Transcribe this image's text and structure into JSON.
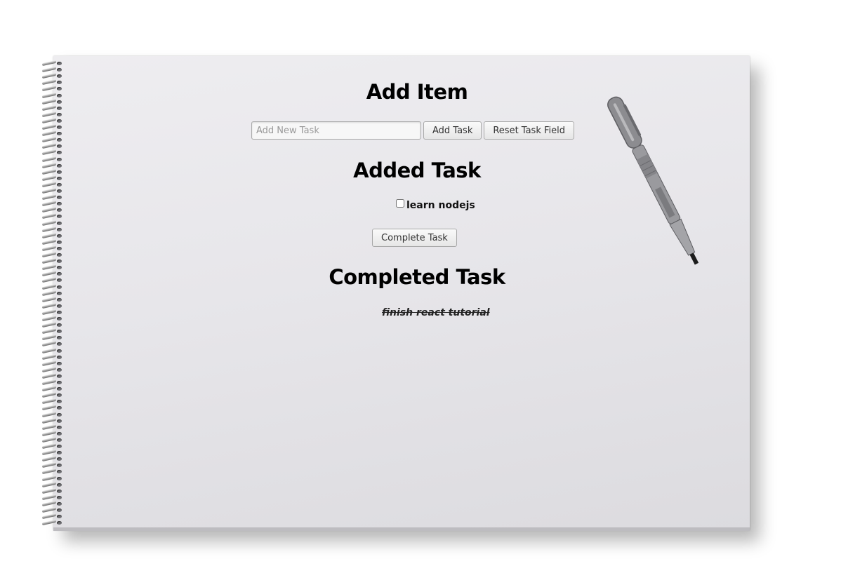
{
  "add_section": {
    "title": "Add Item",
    "input_placeholder": "Add New Task",
    "input_value": "",
    "add_button": "Add Task",
    "reset_button": "Reset Task Field"
  },
  "added_section": {
    "title": "Added Task",
    "tasks": [
      {
        "label": "learn nodejs",
        "checked": false
      }
    ],
    "complete_button": "Complete Task"
  },
  "completed_section": {
    "title": "Completed Task",
    "tasks": [
      {
        "label": "finish react tutorial"
      }
    ]
  },
  "decor": {
    "sheet_color": "#e8e7eb",
    "pen_color": "#8e8e92"
  }
}
